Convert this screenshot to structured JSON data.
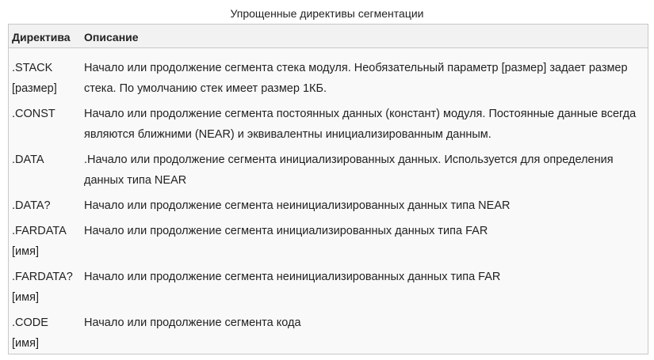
{
  "caption": "Упрощенные директивы сегментации",
  "headers": {
    "directive": "Директива",
    "description": "Описание"
  },
  "rows": [
    {
      "directive": ".STACK\n[размер]",
      "description": "Начало или продолжение сегмента стека модуля. Необязательный параметр [размер] задает размер стека. По умолчанию стек имеет размер 1КБ."
    },
    {
      "directive": ".CONST",
      "description": "Начало или продолжение сегмента постоянных данных (констант) модуля. Постоянные данные всегда являются ближними (NEAR) и эквивалентны инициализированным данным."
    },
    {
      "directive": ".DATA",
      "description": ".Начало или продолжение сегмента инициализированных данных. Используется для определения данных типа NEAR"
    },
    {
      "directive": ".DATA?",
      "description": "Начало или продолжение сегмента неинициализированных данных типа NEAR"
    },
    {
      "directive": ".FARDATA\n[имя]",
      "description": "Начало или продолжение сегмента инициализированных данных типа FAR"
    },
    {
      "directive": ".FARDATA?\n[имя]",
      "description": "Начало или продолжение сегмента неинициализированных данных типа FAR"
    },
    {
      "directive": ".CODE\n[имя]",
      "description": "Начало или продолжение сегмента кода"
    }
  ]
}
